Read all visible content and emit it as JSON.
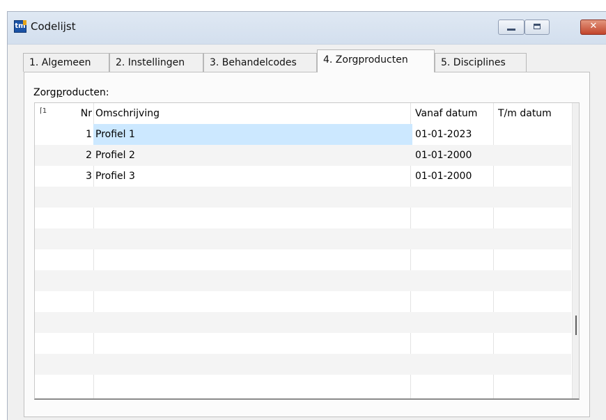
{
  "window": {
    "title": "Codelijst",
    "app_icon_text": "tm"
  },
  "tabs": [
    {
      "label": "1. Algemeen"
    },
    {
      "label": "2. Instellingen"
    },
    {
      "label": "3. Behandelcodes"
    },
    {
      "label": "4. Zorgproducten",
      "active": true
    },
    {
      "label": "5. Disciplines"
    }
  ],
  "grid": {
    "label_prefix": "Zorg",
    "label_underlined": "p",
    "label_suffix": "roducten:",
    "header_icon": "1",
    "columns": {
      "nr": "Nr",
      "omschrijving": "Omschrijving",
      "vanaf": "Vanaf datum",
      "tm": "T/m datum"
    },
    "rows": [
      {
        "nr": "1",
        "omschrijving": "Profiel 1",
        "vanaf": "01-01-2023",
        "tm": ""
      },
      {
        "nr": "2",
        "omschrijving": "Profiel 2",
        "vanaf": "01-01-2000",
        "tm": ""
      },
      {
        "nr": "3",
        "omschrijving": "Profiel 3",
        "vanaf": "01-01-2000",
        "tm": ""
      }
    ],
    "selected_row": 1
  },
  "colors": {
    "selection": "#cce8ff",
    "stripe": "#f4f4f4",
    "window_bg": "#f0f0f0",
    "close_button": "#c2452c"
  },
  "icons": [
    "app-logo-icon",
    "minimize-icon",
    "maximize-icon",
    "close-icon",
    "sort-indicator-icon"
  ]
}
